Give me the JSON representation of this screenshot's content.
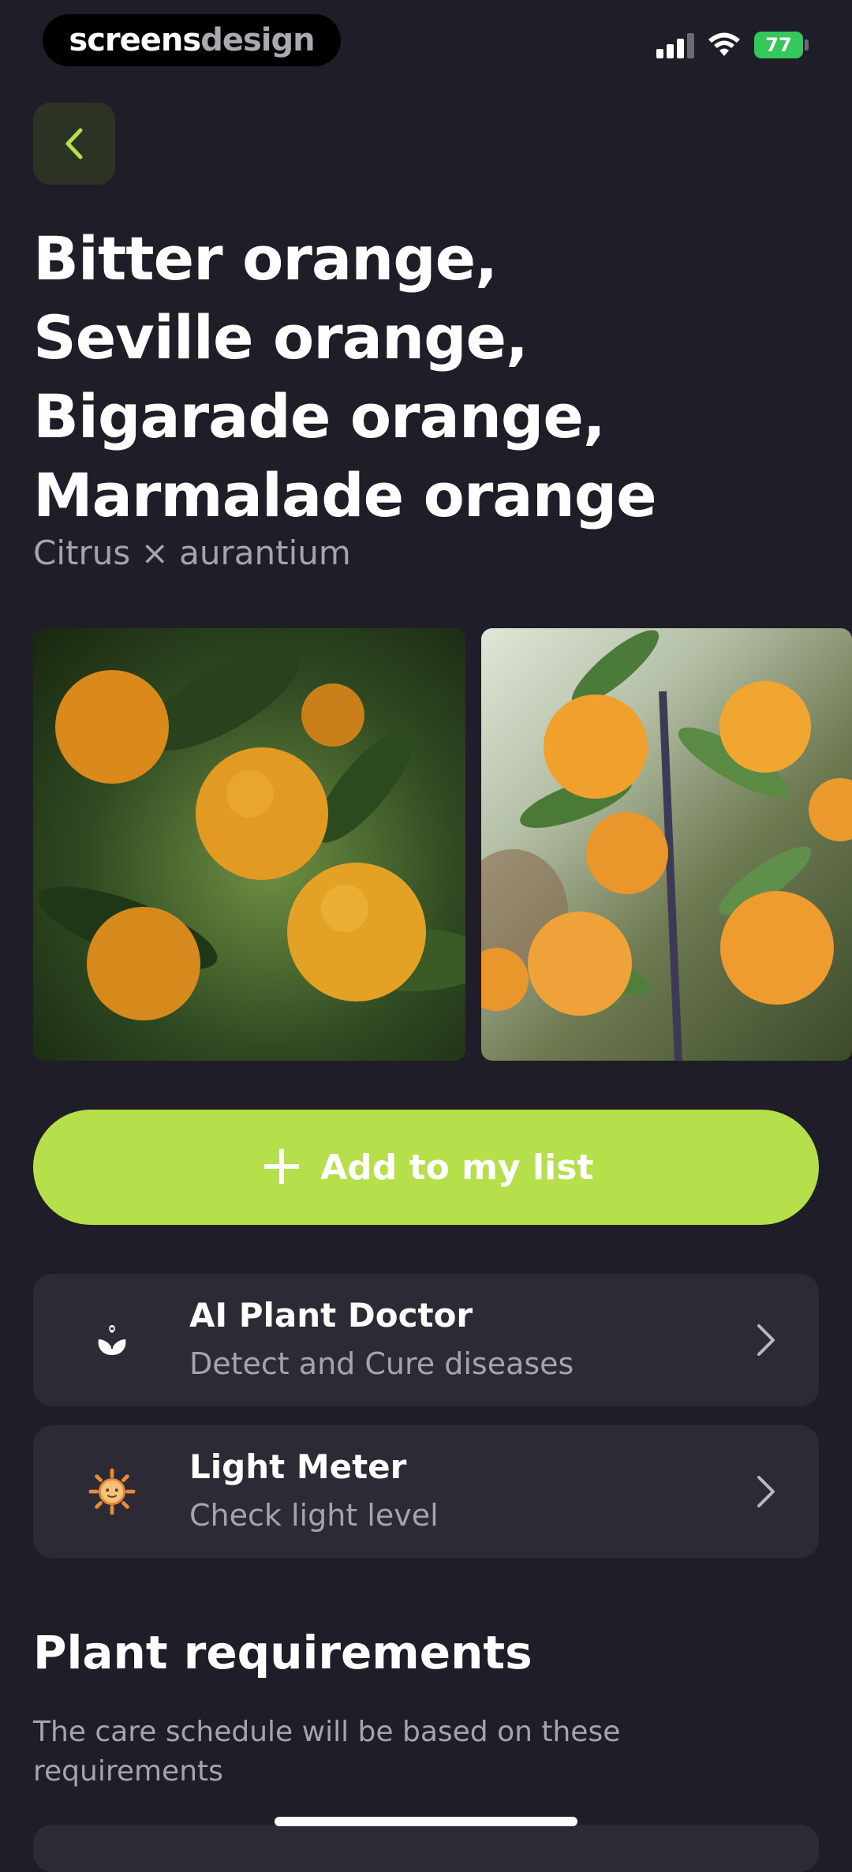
{
  "status_bar": {
    "brand_left": "screens",
    "brand_right": "design",
    "battery_level": "77",
    "icons": [
      "cellular-signal-icon",
      "wifi-icon",
      "battery-icon"
    ]
  },
  "header": {
    "back_icon": "chevron-left-icon"
  },
  "plant": {
    "title_lines": [
      "Bitter orange,",
      "Seville orange,",
      "Bigarade orange,",
      "Marmalade orange"
    ],
    "scientific_name": "Citrus × aurantium"
  },
  "gallery": {
    "photos": [
      "orange-tree-photo",
      "orange-tree-photo"
    ]
  },
  "actions": {
    "add_label": "Add to my list",
    "add_icon": "plus-icon"
  },
  "features": [
    {
      "title": "AI Plant Doctor",
      "subtitle": "Detect and Cure diseases",
      "icon": "plant-doctor-icon"
    },
    {
      "title": "Light Meter",
      "subtitle": "Check light level",
      "icon": "sun-icon"
    }
  ],
  "requirements": {
    "title": "Plant requirements",
    "description": "The care schedule will be based on these requirements"
  },
  "colors": {
    "background": "#1f1e28",
    "card": "#2b2a35",
    "accent": "#b5e04c",
    "muted_text": "#a5a4ae",
    "battery": "#34c759"
  }
}
